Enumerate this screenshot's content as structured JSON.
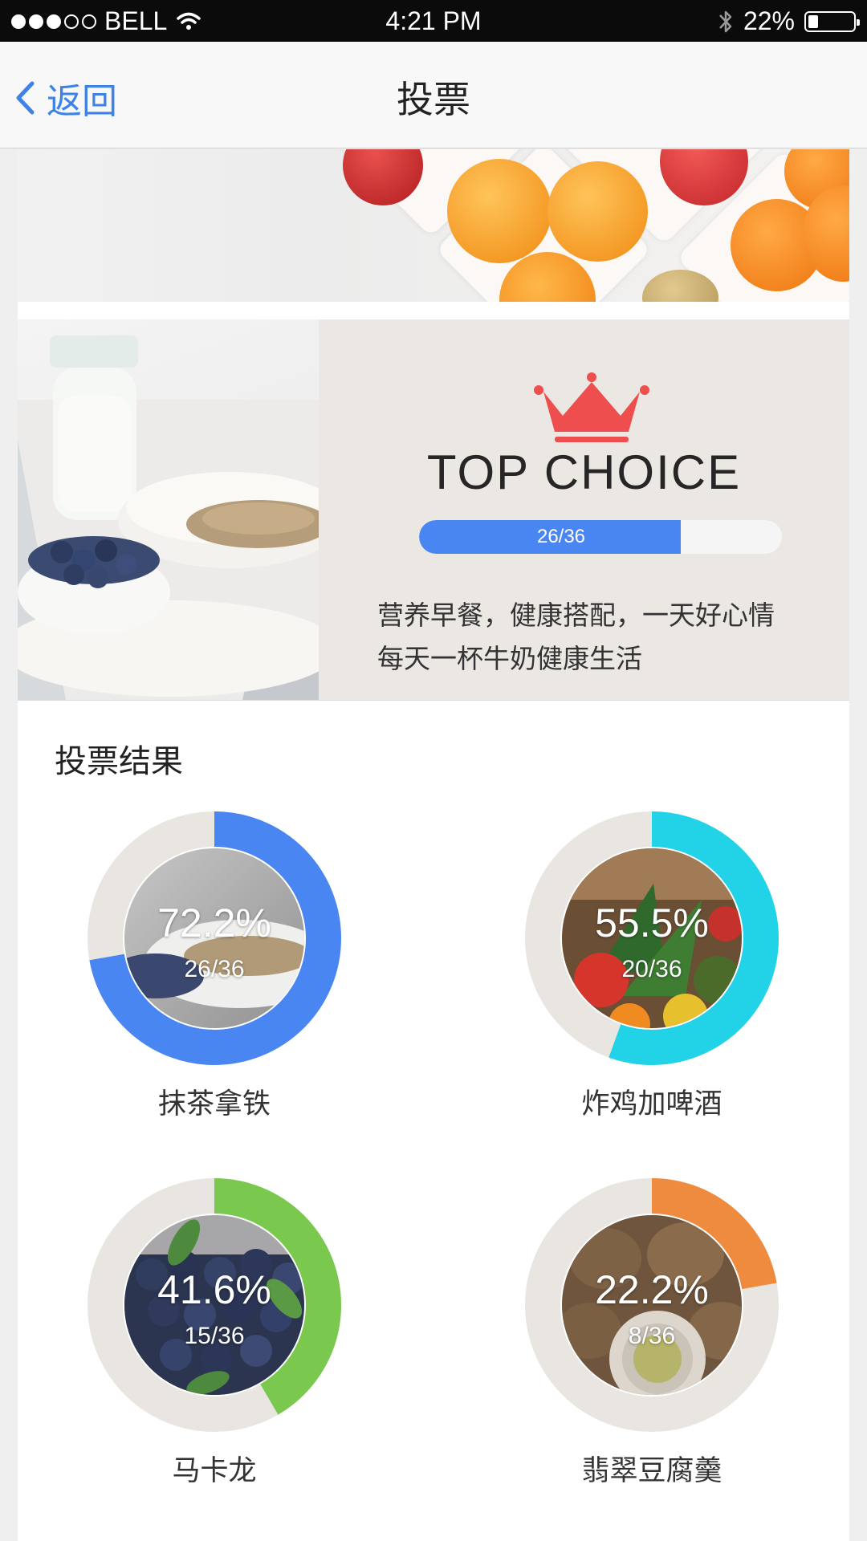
{
  "status_bar": {
    "signal_full": 3,
    "signal_total": 5,
    "carrier": "BELL",
    "time": "4:21 PM",
    "battery": "22%",
    "battery_level": 0.22
  },
  "nav": {
    "back_label": "返回",
    "title": "投票"
  },
  "featured": {
    "heading": "TOP CHOICE",
    "progress_text": "26/36",
    "progress_fraction": 0.722,
    "accent_color": "#4a86f2",
    "description_line1": "营养早餐，健康搭配，一天好心情",
    "description_line2": "每天一杯牛奶健康生活"
  },
  "results": {
    "title": "投票结果",
    "items": [
      {
        "name": "抹茶拿铁",
        "percent": "72.2%",
        "count": "26/36",
        "fraction": 0.722,
        "color": "#4a86f2"
      },
      {
        "name": "炸鸡加啤酒",
        "percent": "55.5%",
        "count": "20/36",
        "fraction": 0.555,
        "color": "#22d3e8"
      },
      {
        "name": "马卡龙",
        "percent": "41.6%",
        "count": "15/36",
        "fraction": 0.416,
        "color": "#7ac84e"
      },
      {
        "name": "翡翠豆腐羹",
        "percent": "22.2%",
        "count": "8/36",
        "fraction": 0.222,
        "color": "#ef8b3f"
      }
    ]
  },
  "icons": {
    "back": "chevron-left-icon",
    "wifi": "wifi-icon",
    "bluetooth": "bluetooth-icon",
    "battery": "battery-icon",
    "crown": "crown-icon"
  }
}
